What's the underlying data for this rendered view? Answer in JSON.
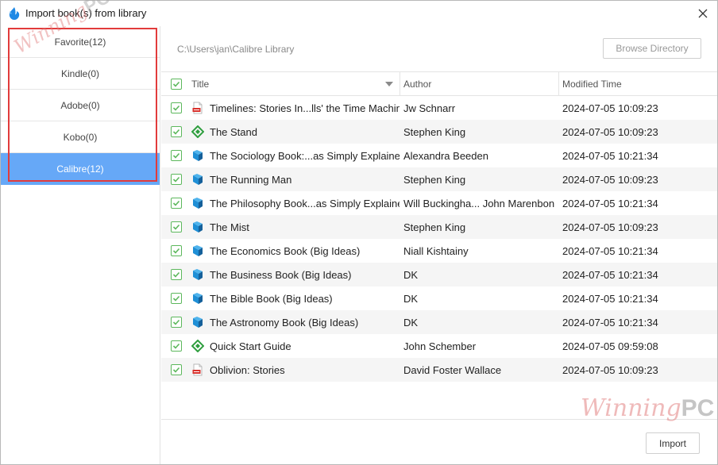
{
  "window": {
    "title": "Import book(s) from library"
  },
  "sidebar": {
    "items": [
      {
        "label": "Favorite(12)",
        "active": false
      },
      {
        "label": "Kindle(0)",
        "active": false
      },
      {
        "label": "Adobe(0)",
        "active": false
      },
      {
        "label": "Kobo(0)",
        "active": false
      },
      {
        "label": "Calibre(12)",
        "active": true
      }
    ]
  },
  "path": {
    "current": "C:\\Users\\jan\\Calibre Library",
    "browse_label": "Browse Directory"
  },
  "table": {
    "headers": {
      "title": "Title",
      "author": "Author",
      "modified": "Modified Time"
    },
    "rows": [
      {
        "icon": "pdf-icon",
        "title": "Timelines: Stories In...lls' the Time Machine",
        "author": "Jw Schnarr",
        "modified": "2024-07-05 10:09:23",
        "checked": true
      },
      {
        "icon": "epub-icon",
        "title": "The Stand",
        "author": "Stephen King",
        "modified": "2024-07-05 10:09:23",
        "checked": true
      },
      {
        "icon": "ebook-icon",
        "title": "The Sociology Book:...as Simply Explained",
        "author": "Alexandra Beeden",
        "modified": "2024-07-05 10:21:34",
        "checked": true
      },
      {
        "icon": "ebook-icon",
        "title": "The Running Man",
        "author": "Stephen King",
        "modified": "2024-07-05 10:09:23",
        "checked": true
      },
      {
        "icon": "ebook-icon",
        "title": "The Philosophy Book...as Simply Explained",
        "author": "Will Buckingha... John Marenbon",
        "modified": "2024-07-05 10:21:34",
        "checked": true
      },
      {
        "icon": "ebook-icon",
        "title": "The Mist",
        "author": "Stephen King",
        "modified": "2024-07-05 10:09:23",
        "checked": true
      },
      {
        "icon": "ebook-icon",
        "title": "The Economics Book (Big Ideas)",
        "author": "Niall Kishtainy",
        "modified": "2024-07-05 10:21:34",
        "checked": true
      },
      {
        "icon": "ebook-icon",
        "title": "The Business Book (Big Ideas)",
        "author": "DK",
        "modified": "2024-07-05 10:21:34",
        "checked": true
      },
      {
        "icon": "ebook-icon",
        "title": "The Bible Book (Big Ideas)",
        "author": "DK",
        "modified": "2024-07-05 10:21:34",
        "checked": true
      },
      {
        "icon": "ebook-icon",
        "title": "The Astronomy Book (Big Ideas)",
        "author": "DK",
        "modified": "2024-07-05 10:21:34",
        "checked": true
      },
      {
        "icon": "epub-icon",
        "title": "Quick Start Guide",
        "author": "John Schember",
        "modified": "2024-07-05 09:59:08",
        "checked": true
      },
      {
        "icon": "pdf-icon",
        "title": "Oblivion: Stories",
        "author": "David Foster Wallace",
        "modified": "2024-07-05 10:09:23",
        "checked": true
      }
    ]
  },
  "footer": {
    "import_label": "Import"
  },
  "watermark": {
    "script": "Winning",
    "bold": "PC"
  },
  "colors": {
    "accent": "#66a8f7",
    "check": "#5cb85c",
    "highlight": "#e23b3b",
    "epub": "#2e9e3e",
    "ebook": "#1f8fd6",
    "pdf": "#d9302c"
  }
}
